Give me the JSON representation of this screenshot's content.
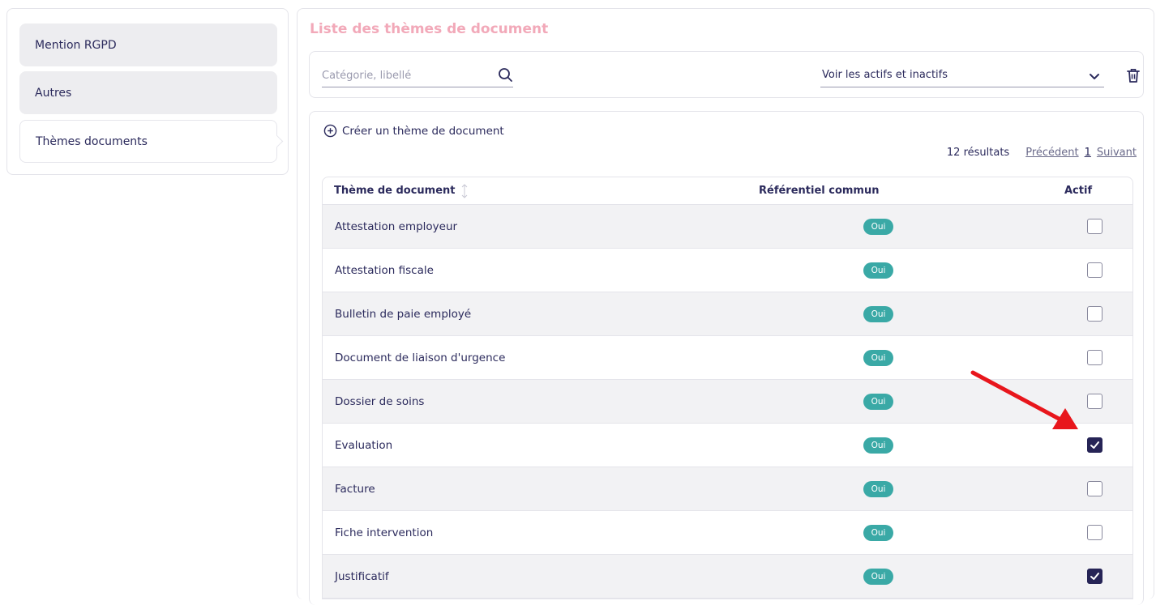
{
  "sidebar": {
    "items": [
      {
        "label": "Mention RGPD"
      },
      {
        "label": "Autres"
      },
      {
        "label": "Thèmes documents"
      }
    ]
  },
  "page": {
    "title": "Liste des thèmes de document"
  },
  "filters": {
    "search_placeholder": "Catégorie, libellé",
    "status_select": "Voir les actifs et inactifs"
  },
  "list": {
    "create_label": "Créer un thème de document",
    "results": "12 résultats",
    "prev": "Précédent",
    "page": "1",
    "next": "Suivant"
  },
  "table": {
    "headers": [
      "Thème de document",
      "Référentiel commun",
      "Actif"
    ],
    "rows": [
      {
        "name": "Attestation employeur",
        "commun": "Oui",
        "actif": false
      },
      {
        "name": "Attestation fiscale",
        "commun": "Oui",
        "actif": false
      },
      {
        "name": "Bulletin de paie employé",
        "commun": "Oui",
        "actif": false
      },
      {
        "name": "Document de liaison d'urgence",
        "commun": "Oui",
        "actif": false
      },
      {
        "name": "Dossier de soins",
        "commun": "Oui",
        "actif": false
      },
      {
        "name": "Evaluation",
        "commun": "Oui",
        "actif": true
      },
      {
        "name": "Facture",
        "commun": "Oui",
        "actif": false
      },
      {
        "name": "Fiche intervention",
        "commun": "Oui",
        "actif": false
      },
      {
        "name": "Justificatif",
        "commun": "Oui",
        "actif": true
      }
    ]
  },
  "colors": {
    "title": "#f2a9b9",
    "badge": "#3aa9a6",
    "checked": "#262456",
    "annotation_arrow": "#e8161c"
  }
}
